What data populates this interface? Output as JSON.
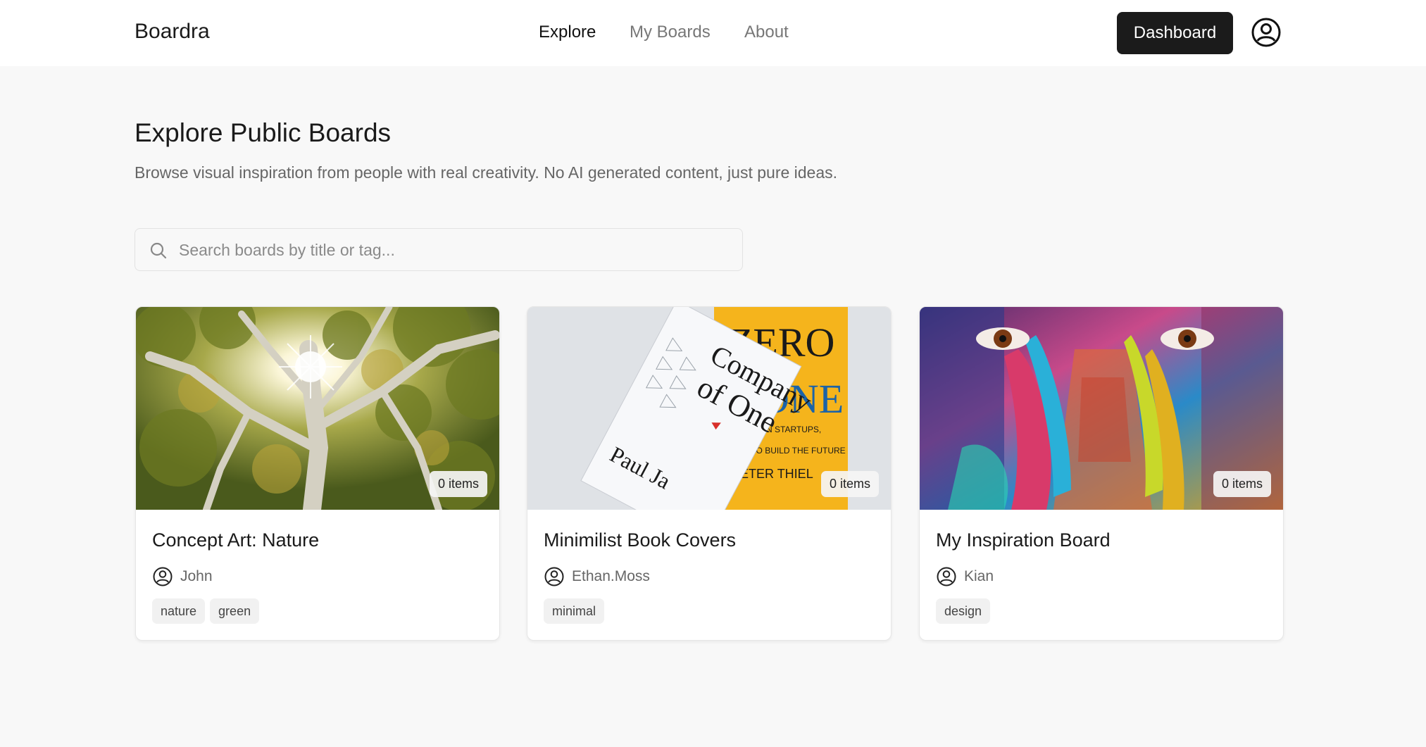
{
  "header": {
    "brand": "Boardra",
    "nav": [
      {
        "label": "Explore",
        "active": true
      },
      {
        "label": "My Boards",
        "active": false
      },
      {
        "label": "About",
        "active": false
      }
    ],
    "dashboard_label": "Dashboard",
    "avatar_icon": "user-circle-icon"
  },
  "page": {
    "title": "Explore Public Boards",
    "subtitle": "Browse visual inspiration from people with real creativity. No AI generated content, just pure ideas."
  },
  "search": {
    "placeholder": "Search boards by title or tag...",
    "value": "",
    "icon": "search-icon"
  },
  "boards": [
    {
      "title": "Concept Art: Nature",
      "owner": "John",
      "items": "0 items",
      "tags": [
        "nature",
        "green"
      ],
      "image": "sunlit-tree-canopy"
    },
    {
      "title": "Minimilist Book Covers",
      "owner": "Ethan.Moss",
      "items": "0 items",
      "tags": [
        "minimal"
      ],
      "image": "book-covers"
    },
    {
      "title": "My Inspiration Board",
      "owner": "Kian",
      "items": "0 items",
      "tags": [
        "design"
      ],
      "image": "painted-face"
    }
  ],
  "colors": {
    "accent": "#1b1b1b",
    "background": "#f8f8f8",
    "card": "#ffffff"
  }
}
